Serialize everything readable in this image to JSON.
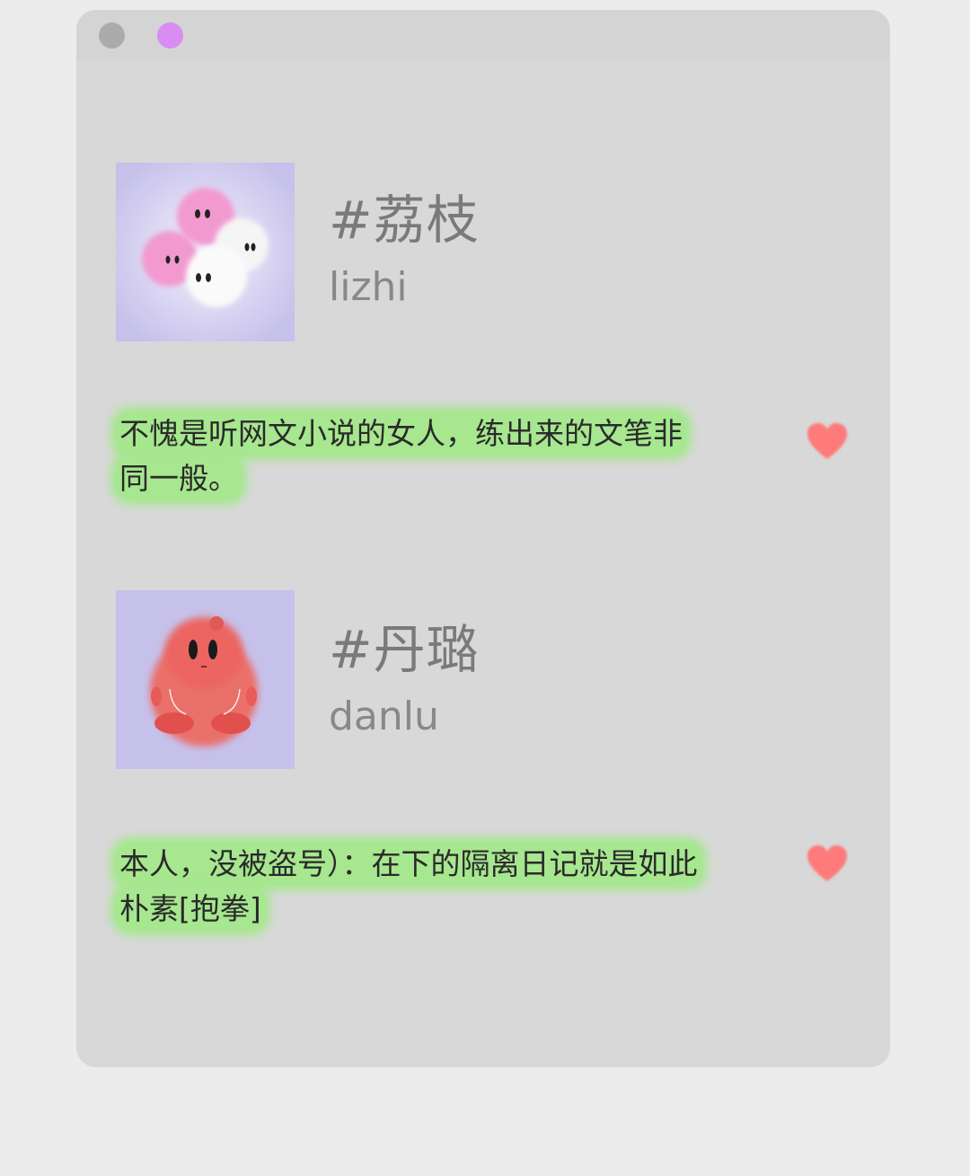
{
  "window": {
    "accent_colors": {
      "dot_gray": "#ababab",
      "dot_violet": "#d98cf2",
      "bubble": "#a6e78f",
      "heart": "#ff7a7a"
    }
  },
  "posts": [
    {
      "tag": "#荔枝",
      "handle": "lizhi",
      "avatar_icon": "fluffy-puffballs-icon",
      "message": "不愧是听网文小说的女人，练出来的文笔非同一般。"
    },
    {
      "tag": "#丹璐",
      "handle": "danlu",
      "avatar_icon": "red-blob-character-icon",
      "message": "本人，没被盗号）：在下的隔离日记就是如此朴素[抱拳]"
    }
  ]
}
